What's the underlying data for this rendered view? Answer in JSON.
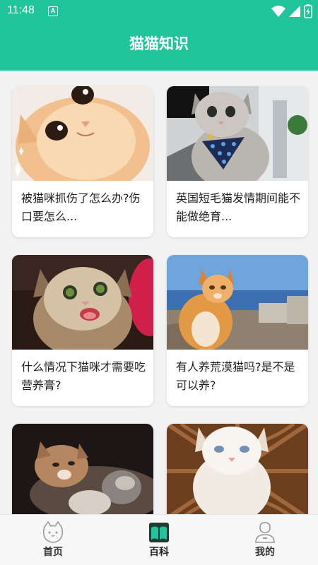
{
  "status_bar": {
    "time": "11:48",
    "input_indicator": "A",
    "icons": [
      "wifi-icon",
      "signal-icon",
      "battery-icon"
    ]
  },
  "header": {
    "title": "猫猫知识"
  },
  "articles": [
    {
      "title": "被猫咪抓伤了怎么办?伤口要怎么...",
      "image": "orange-kitten-photo"
    },
    {
      "title": "英国短毛猫发情期间能不能做绝育...",
      "image": "tabby-cat-with-bandana-photo"
    },
    {
      "title": "什么情况下猫咪才需要吃营养膏?",
      "image": "meowing-kitten-photo"
    },
    {
      "title": "有人养荒漠猫吗?是不是可以养?",
      "image": "ginger-cat-by-sea-photo"
    },
    {
      "title": "",
      "image": "cat-with-kittens-photo"
    },
    {
      "title": "",
      "image": "white-kitten-photo"
    }
  ],
  "bottom_nav": {
    "items": [
      {
        "label": "首页",
        "icon": "cat-face-icon",
        "active": false
      },
      {
        "label": "百科",
        "icon": "open-book-icon",
        "active": true
      },
      {
        "label": "我的",
        "icon": "person-icon",
        "active": false
      }
    ]
  },
  "colors": {
    "primary": "#20c59b",
    "active_label": "#1f1f1f",
    "inactive_label": "#333333",
    "inactive_icon": "#9a9a9a"
  }
}
